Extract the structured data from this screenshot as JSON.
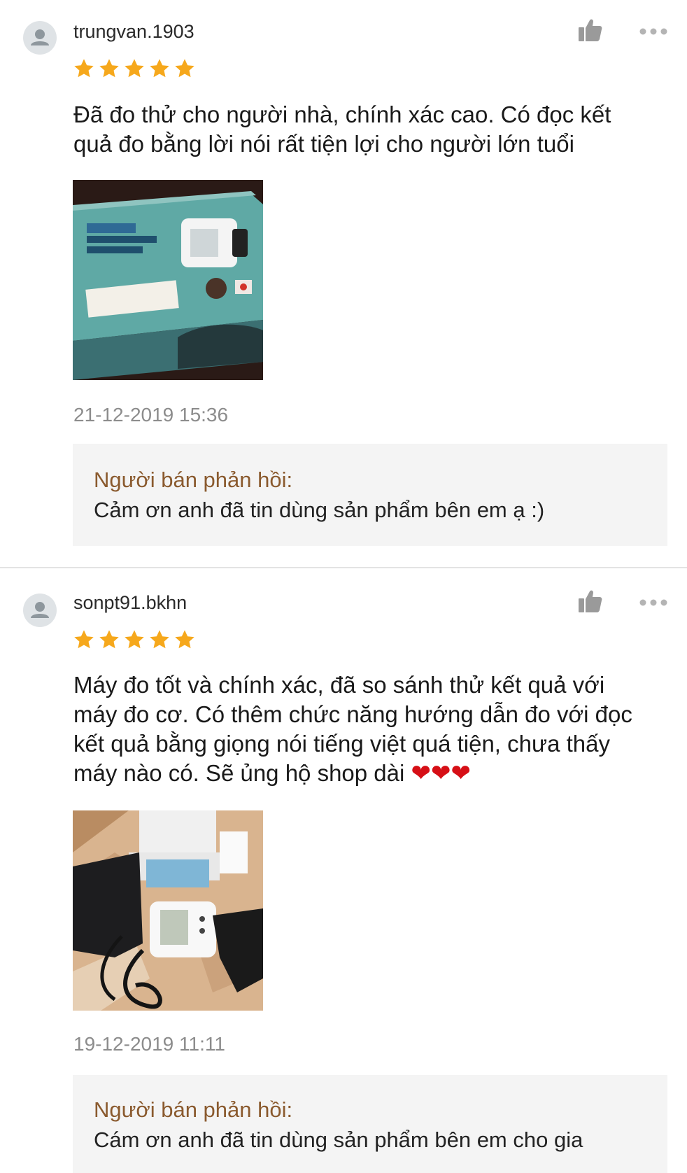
{
  "reviews": [
    {
      "username": "trungvan.1903",
      "rating": 5,
      "comment": "Đã đo thử cho người nhà, chính xác cao. Có đọc kết quả đo bằng lời nói rất tiện lợi cho người lớn tuổi",
      "comment_suffix": "",
      "timestamp": "21-12-2019 15:36",
      "reply_title": "Người bán phản hồi:",
      "reply_text": "Cảm ơn anh đã tin dùng sản phẩm bên em ạ :)"
    },
    {
      "username": "sonpt91.bkhn",
      "rating": 5,
      "comment": "Máy đo tốt và chính xác, đã so sánh thử kết quả với máy đo cơ. Có thêm chức năng hướng dẫn đo với đọc kết quả bằng giọng nói tiếng việt quá tiện, chưa thấy máy nào có. Sẽ ủng hộ shop dài ",
      "comment_suffix": "❤❤❤",
      "timestamp": "19-12-2019 11:11",
      "reply_title": "Người bán phản hồi:",
      "reply_text": "Cám ơn anh đã tin dùng sản phẩm bên em cho gia"
    }
  ],
  "icons": {
    "like": "thumbs-up-icon",
    "more": "more-options-icon",
    "star": "star-icon",
    "avatar": "user-avatar-icon"
  },
  "colors": {
    "star": "#f6a81c",
    "reply_title": "#8a5a2e",
    "heart": "#d60f16",
    "reply_bg": "#f4f4f4"
  }
}
